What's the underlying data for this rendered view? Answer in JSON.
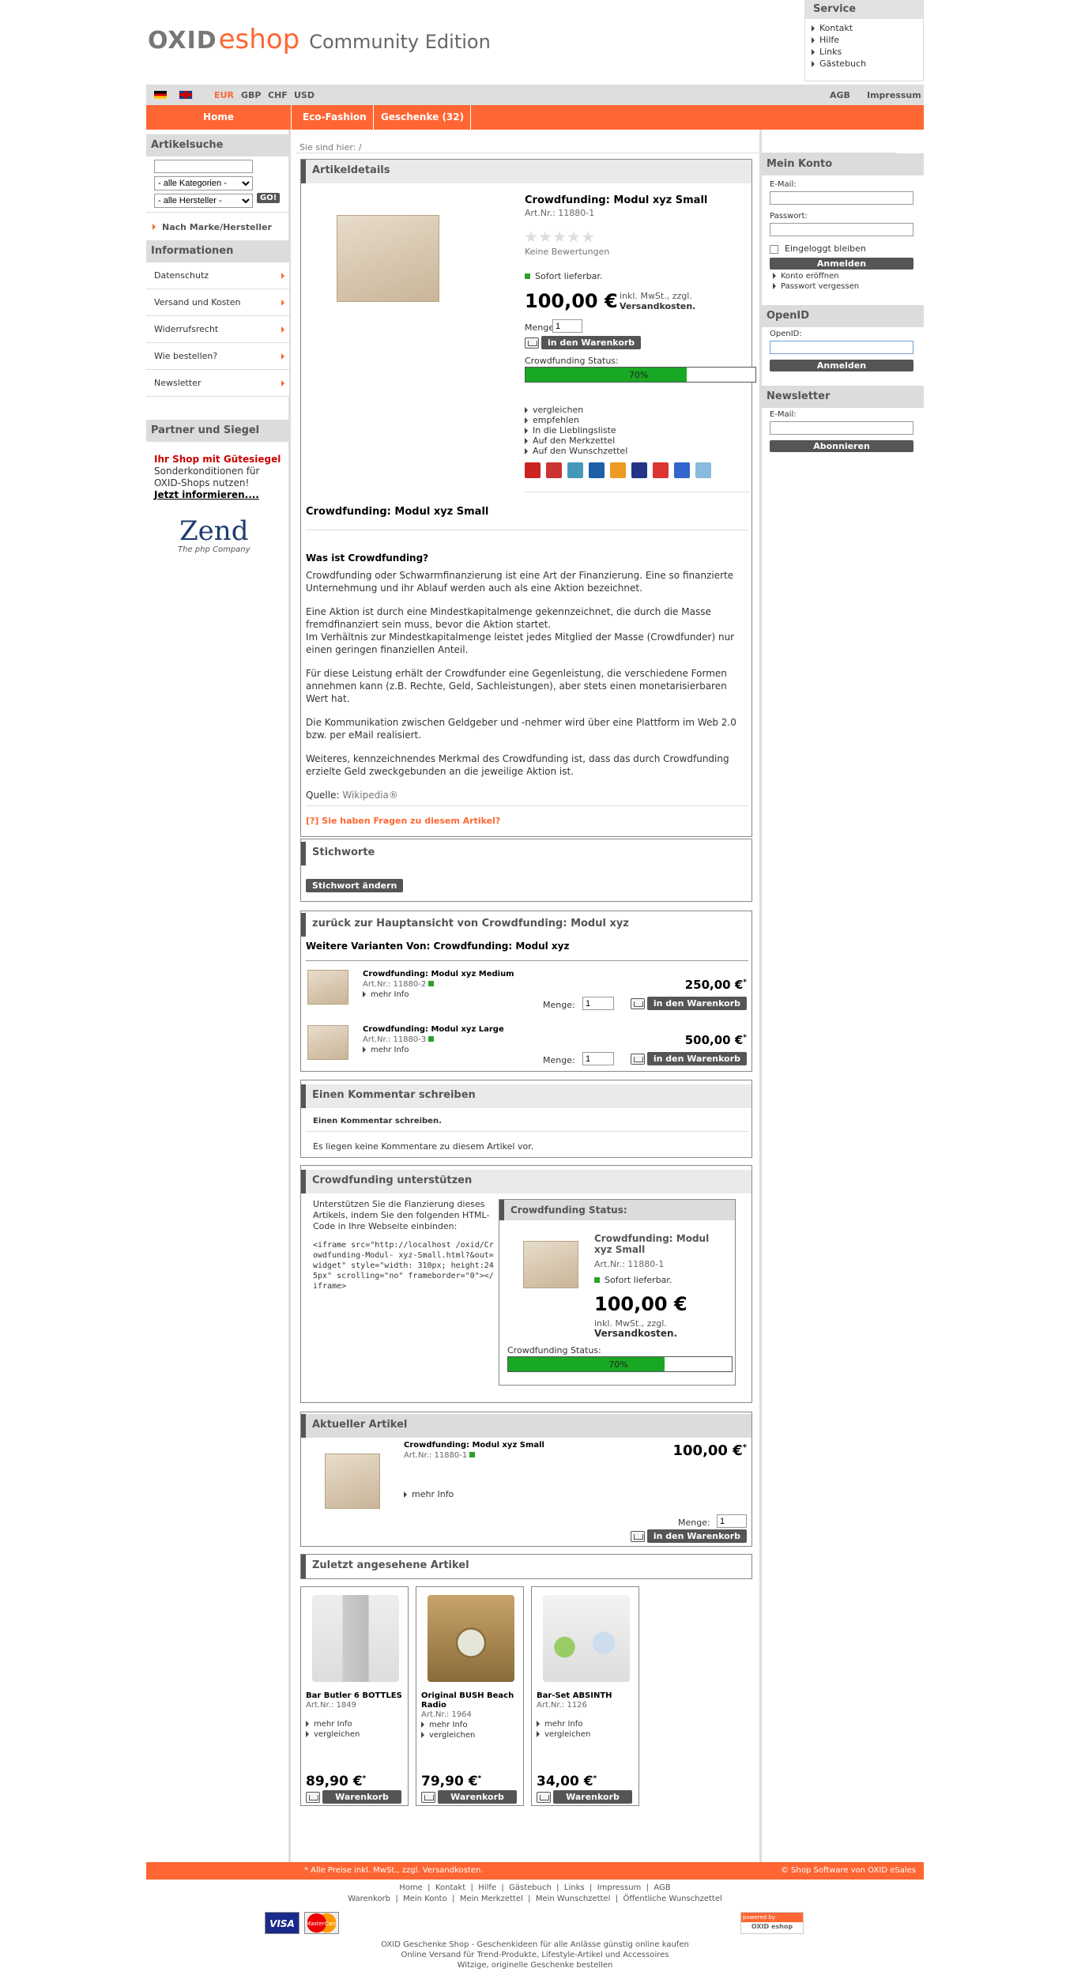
{
  "header": {
    "logo_oxid": "OXID",
    "logo_eshop": "eshop",
    "edition": "Community Edition"
  },
  "service": {
    "title": "Service",
    "links": [
      "Kontakt",
      "Hilfe",
      "Links",
      "Gästebuch"
    ]
  },
  "topbar": {
    "currencies": [
      "EUR",
      "GBP",
      "CHF",
      "USD"
    ],
    "active_currency": "EUR",
    "agb": "AGB",
    "impressum": "Impressum"
  },
  "nav": {
    "home": "Home",
    "cats": [
      "Eco-Fashion",
      "Geschenke (32)"
    ]
  },
  "breadcrumb": "Sie sind hier: /",
  "left": {
    "search_title": "Artikelsuche",
    "cat_select": "- alle Kategorien -",
    "mfr_select": "- alle Hersteller -",
    "go": "GO!",
    "brand_link": "Nach Marke/Hersteller",
    "info_title": "Informationen",
    "info_items": [
      "Datenschutz",
      "Versand und Kosten",
      "Widerrufsrecht",
      "Wie bestellen?",
      "Newsletter"
    ],
    "partner_title": "Partner und Siegel",
    "seal_red": "Ihr Shop mit Gütesiegel",
    "seal_text": "Sonderkonditionen für OXID-Shops nutzen!",
    "seal_link": "Jetzt informieren....",
    "zend_logo": "Zend",
    "zend_sub": "The php Company"
  },
  "product": {
    "box_title": "Artikeldetails",
    "title": "Crowdfunding: Modul xyz Small",
    "artnr": "Art.Nr.: 11880-1",
    "no_reviews": "Keine Bewertungen",
    "stock": "Sofort lieferbar.",
    "price": "100,00 €",
    "tax1": "inkl. MwSt., zzgl.",
    "tax2": "Versandkosten.",
    "qty_label": "Menge:",
    "qty": "1",
    "cart_btn": "in den Warenkorb",
    "status_label": "Crowdfunding Status:",
    "status_pct": "70%",
    "progress": 0.7,
    "actions": [
      "vergleichen",
      "empfehlen",
      "In die Lieblingsliste",
      "Auf den Merkzettel",
      "Auf den Wunschzettel"
    ],
    "social_colors": [
      "#cc2222",
      "#cc3333",
      "#4499bb",
      "#1f5fa6",
      "#ee9922",
      "#223388",
      "#dd3333",
      "#3366cc",
      "#88bbdd"
    ],
    "desc_title": "Crowdfunding: Modul xyz Small",
    "desc_heading": "Was ist Crowdfunding?",
    "desc_p1": "Crowdfunding oder Schwarmfinanzierung ist eine Art der Finanzierung. Eine so finanzierte Unternehmung und ihr Ablauf werden auch als eine Aktion bezeichnet.",
    "desc_p2a": "Eine Aktion ist durch eine Mindestkapitalmenge gekennzeichnet, die durch die Masse fremdfinanziert sein muss, bevor die Aktion startet.",
    "desc_p2b": "Im Verhältnis zur Mindestkapitalmenge leistet jedes Mitglied der Masse (Crowdfunder) nur einen geringen finanziellen Anteil.",
    "desc_p3": "Für diese Leistung erhält der Crowdfunder eine Gegenleistung, die verschiedene Formen annehmen kann (z.B. Rechte, Geld, Sachleistungen), aber stets einen monetarisierbaren Wert hat.",
    "desc_p4": "Die Kommunikation zwischen Geldgeber und -nehmer wird über eine Plattform im Web 2.0 bzw. per eMail realisiert.",
    "desc_p5": "Weiteres, kennzeichnendes Merkmal des Crowdfunding ist, dass das durch Crowdfunding erzielte Geld zweckgebunden an die jeweilige Aktion ist.",
    "source_label": "Quelle:",
    "source_link": "Wikipedia®",
    "question": "[?] Sie haben Fragen zu diesem Artikel?"
  },
  "tags": {
    "title": "Stichworte",
    "btn": "Stichwort ändern"
  },
  "variants": {
    "back": "zurück zur Hauptansicht von Crowdfunding: Modul xyz",
    "heading": "Weitere Varianten Von: Crowdfunding: Modul xyz",
    "items": [
      {
        "name": "Crowdfunding: Modul xyz Medium",
        "artnr": "Art.Nr.: 11880-2",
        "more": "mehr Info",
        "qty_label": "Menge:",
        "qty": "1",
        "price": "250,00 €",
        "star": "*",
        "cart": "in den Warenkorb"
      },
      {
        "name": "Crowdfunding: Modul xyz Large",
        "artnr": "Art.Nr.: 11880-3",
        "more": "mehr Info",
        "qty_label": "Menge:",
        "qty": "1",
        "price": "500,00 €",
        "star": "*",
        "cart": "in den Warenkorb"
      }
    ]
  },
  "comments": {
    "title": "Einen Kommentar schreiben",
    "link": "Einen Kommentar schreiben.",
    "none": "Es liegen keine Kommentare zu diesem Artikel vor."
  },
  "support": {
    "title": "Crowdfunding unterstützen",
    "intro": "Unterstützen Sie die Fianzierung dieses Artikels, indem Sie den folgenden HTML-Code in Ihre Webseite einbinden:",
    "code": "<iframe src=\"http://localhost /oxid/Crowdfunding-Modul- xyz-Small.html?&out=widget\" style=\"width: 310px; height:245px\" scrolling=\"no\" frameborder=\"0\"></iframe>",
    "widget_title": "Crowdfunding Status:",
    "widget_name": "Crowdfunding: Modul xyz Small",
    "widget_artnr": "Art.Nr.: 11880-1",
    "widget_stock": "Sofort lieferbar.",
    "widget_price": "100,00 €",
    "widget_tax1": "inkl. MwSt., zzgl.",
    "widget_tax2": "Versandkosten.",
    "widget_status": "Crowdfunding Status:",
    "widget_pct": "70%",
    "progress": 0.7
  },
  "current": {
    "title": "Aktueller Artikel",
    "name": "Crowdfunding: Modul xyz Small",
    "artnr": "Art.Nr.: 11880-1",
    "price": "100,00 €",
    "star": "*",
    "more": "mehr Info",
    "qty_label": "Menge:",
    "qty": "1",
    "cart": "in den Warenkorb"
  },
  "recent": {
    "title": "Zuletzt angesehene Artikel",
    "items": [
      {
        "name": "Bar Butler 6 BOTTLES",
        "artnr": "Art.Nr.: 1849",
        "more": "mehr Info",
        "compare": "vergleichen",
        "price": "89,90 €",
        "star": "*",
        "cart": "Warenkorb"
      },
      {
        "name": "Original BUSH Beach Radio",
        "artnr": "Art.Nr.: 1964",
        "more": "mehr Info",
        "compare": "vergleichen",
        "price": "79,90 €",
        "star": "*",
        "cart": "Warenkorb"
      },
      {
        "name": "Bar-Set ABSINTH",
        "artnr": "Art.Nr.: 1126",
        "more": "mehr Info",
        "compare": "vergleichen",
        "price": "34,00 €",
        "star": "*",
        "cart": "Warenkorb"
      }
    ]
  },
  "right": {
    "account_title": "Mein Konto",
    "email": "E-Mail:",
    "password": "Passwort:",
    "remember": "Eingeloggt bleiben",
    "login": "Anmelden",
    "register": "Konto eröffnen",
    "forgot": "Passwort vergessen",
    "openid_title": "OpenID",
    "openid_label": "OpenID:",
    "openid_login": "Anmelden",
    "newsletter_title": "Newsletter",
    "nl_email": "E-Mail:",
    "subscribe": "Abonnieren"
  },
  "footer": {
    "prices": "* Alle Preise inkl. MwSt., zzgl. Versandkosten.",
    "copyright": "© Shop Software von OXID eSales",
    "links1": [
      "Home",
      "Kontakt",
      "Hilfe",
      "Gästebuch",
      "Links",
      "Impressum",
      "AGB"
    ],
    "links2": [
      "Warenkorb",
      "Mein Konto",
      "Mein Merkzettel",
      "Mein Wunschzettel",
      "Öffentliche Wunschzettel"
    ],
    "visa": "VISA",
    "mastercard": "MasterCard",
    "powered_top": "powered by",
    "powered_bottom": "OXID eshop",
    "tag1": "OXID Geschenke Shop - Geschenkideen für alle Anlässe günstig online kaufen",
    "tag2": "Online Versand für Trend-Produkte, Lifestyle-Artikel und Accessoires",
    "tag3": "Witzige, originelle Geschenke bestellen"
  },
  "colors": {
    "accent": "#ff6633",
    "progress": "#19a824",
    "seal_red": "#cc0000"
  }
}
